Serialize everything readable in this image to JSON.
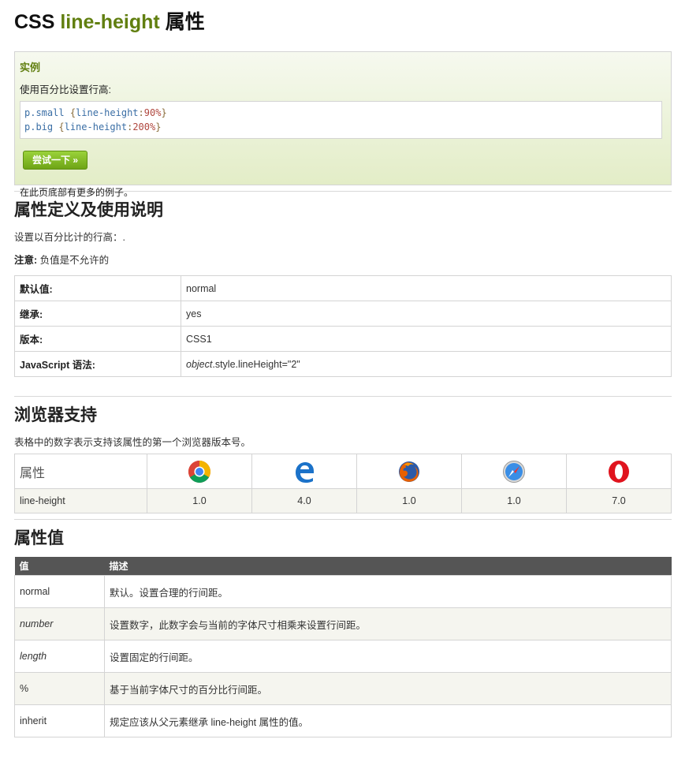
{
  "page_title": {
    "prefix": "CSS",
    "highlight": "line-height",
    "suffix": "属性"
  },
  "example": {
    "title": "实例",
    "description": "使用百分比设置行高:",
    "code": [
      {
        "selector": "p.small",
        "open": "{",
        "property": "line-height",
        "colon": ":",
        "value": "90%",
        "close": "}"
      },
      {
        "selector": "p.big",
        "open": "{",
        "property": "line-height",
        "colon": ":",
        "value": "200%",
        "close": "}"
      }
    ],
    "try_button": "尝试一下 »",
    "footer": "在此页底部有更多的例子。"
  },
  "definition": {
    "heading": "属性定义及使用说明",
    "description": "设置以百分比计的行高：.",
    "note_label": "注意:",
    "note_text": "负值是不允许的",
    "rows": [
      {
        "key": "默认值:",
        "value": "normal"
      },
      {
        "key": "继承:",
        "value": "yes"
      },
      {
        "key": "版本:",
        "value": "CSS1"
      },
      {
        "key": "JavaScript 语法:",
        "value_italic": "object",
        "value_rest": ".style.lineHeight=\"2\""
      }
    ]
  },
  "browser_support": {
    "heading": "浏览器支持",
    "description": "表格中的数字表示支持该属性的第一个浏览器版本号。",
    "header_label": "属性",
    "browsers": [
      "chrome-icon",
      "edge-icon",
      "firefox-icon",
      "safari-icon",
      "opera-icon"
    ],
    "row_label": "line-height",
    "versions": [
      "1.0",
      "4.0",
      "1.0",
      "1.0",
      "7.0"
    ]
  },
  "values": {
    "heading": "属性值",
    "col_value": "值",
    "col_desc": "描述",
    "rows": [
      {
        "value": "normal",
        "desc": "默认。设置合理的行间距。"
      },
      {
        "value": "number",
        "desc": "设置数字，此数字会与当前的字体尺寸相乘来设置行间距。"
      },
      {
        "value": "length",
        "desc": "设置固定的行间距。"
      },
      {
        "value": "%",
        "desc": "基于当前字体尺寸的百分比行间距。"
      },
      {
        "value": "inherit",
        "desc": "规定应该从父元素继承 line-height 属性的值。"
      }
    ]
  },
  "colors": {
    "accent_green": "#617f10",
    "button_green": "#8cc42b",
    "table_header": "#555555"
  }
}
